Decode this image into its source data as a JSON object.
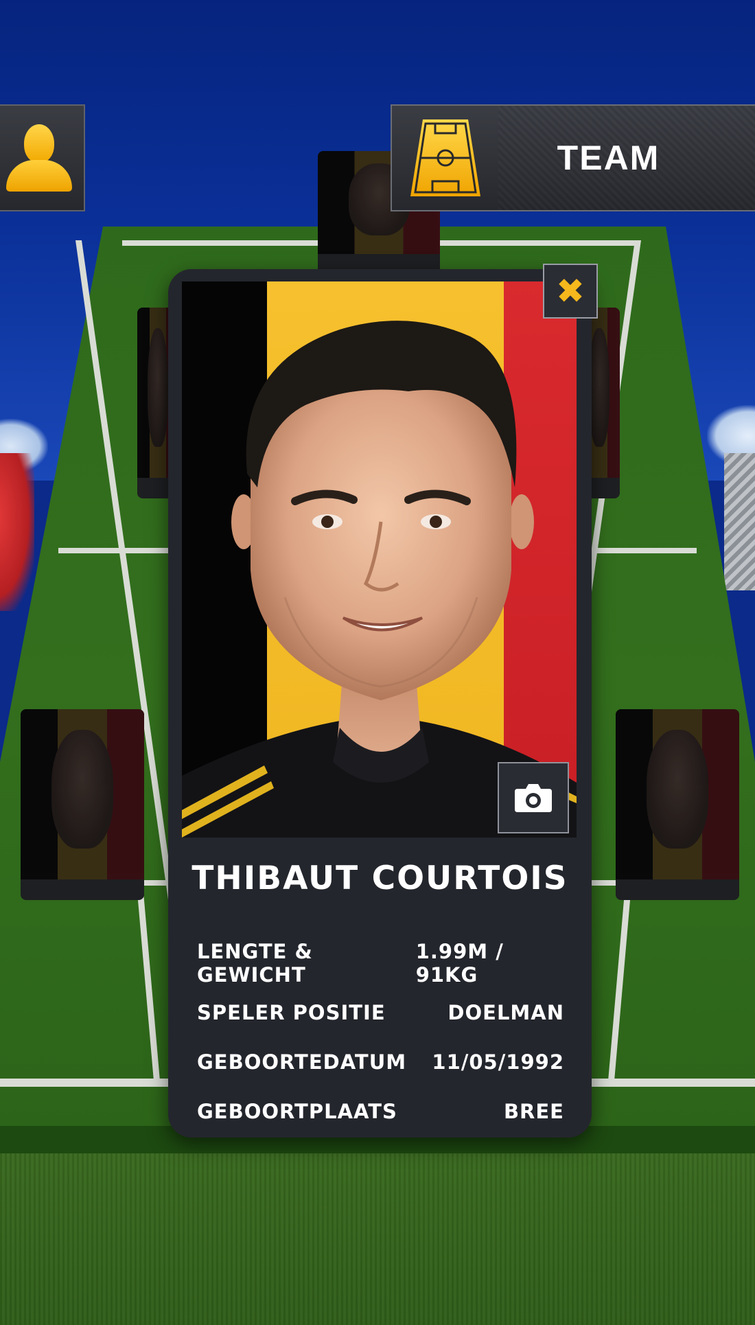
{
  "colors": {
    "accent": "#f6b81c",
    "panel": "#24262d",
    "flag_black": "#050505",
    "flag_yellow": "#f6c02e",
    "flag_red": "#d92a2e",
    "pitch": "#2f6a1c"
  },
  "header": {
    "player_button_icon": "person-icon",
    "team_button": {
      "icon": "soccer-field-icon",
      "label": "TEAM"
    }
  },
  "player_card": {
    "close_icon": "close-icon",
    "close_glyph": "✖",
    "camera_icon": "camera-icon",
    "name": "THIBAUT COURTOIS",
    "stats": [
      {
        "label": "LENGTE & GEWICHT",
        "value": "1.99M / 91KG"
      },
      {
        "label": "SPELER POSITIE",
        "value": "DOELMAN"
      },
      {
        "label": "GEBOORTEDATUM",
        "value": "11/05/1992"
      },
      {
        "label": "GEBOORTPLAATS",
        "value": "BREE"
      }
    ]
  }
}
